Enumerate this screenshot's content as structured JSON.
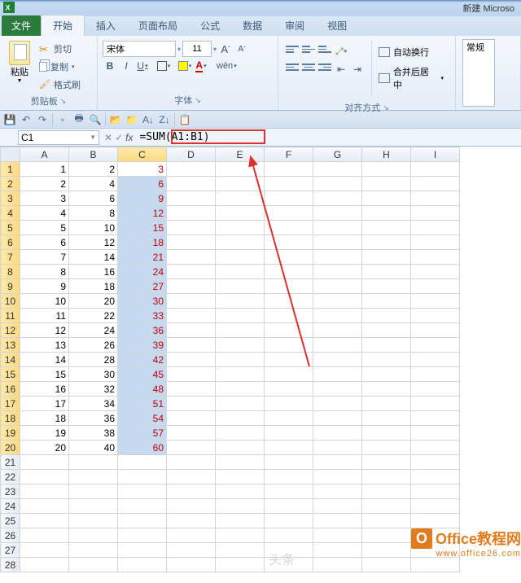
{
  "window_title": "新建 Microso",
  "tabs": {
    "file": "文件",
    "items": [
      "开始",
      "插入",
      "页面布局",
      "公式",
      "数据",
      "审阅",
      "视图"
    ],
    "active": 0
  },
  "clipboard": {
    "paste": "粘贴",
    "cut": "剪切",
    "copy": "复制",
    "painter": "格式刷",
    "label": "剪贴板"
  },
  "font": {
    "name": "宋体",
    "size": "11",
    "bold": "B",
    "italic": "I",
    "underline": "U",
    "inc": "A",
    "dec": "A",
    "label": "字体"
  },
  "align": {
    "wrap": "自动换行",
    "merge": "合并后居中",
    "label": "对齐方式"
  },
  "number": {
    "format": "常规"
  },
  "name_box": "C1",
  "formula": "=SUM(A1:B1)",
  "columns": [
    "A",
    "B",
    "C",
    "D",
    "E",
    "F",
    "G",
    "H",
    "I"
  ],
  "selected_col": "C",
  "rows": 28,
  "sel_rows": [
    1,
    20
  ],
  "chart_data": {
    "type": "table",
    "columns": [
      "A",
      "B",
      "C"
    ],
    "data": [
      [
        1,
        2,
        3
      ],
      [
        2,
        4,
        6
      ],
      [
        3,
        6,
        9
      ],
      [
        4,
        8,
        12
      ],
      [
        5,
        10,
        15
      ],
      [
        6,
        12,
        18
      ],
      [
        7,
        14,
        21
      ],
      [
        8,
        16,
        24
      ],
      [
        9,
        18,
        27
      ],
      [
        10,
        20,
        30
      ],
      [
        11,
        22,
        33
      ],
      [
        12,
        24,
        36
      ],
      [
        13,
        26,
        39
      ],
      [
        14,
        28,
        42
      ],
      [
        15,
        30,
        45
      ],
      [
        16,
        32,
        48
      ],
      [
        17,
        34,
        51
      ],
      [
        18,
        36,
        54
      ],
      [
        19,
        38,
        57
      ],
      [
        20,
        40,
        60
      ]
    ]
  },
  "watermark": {
    "brand": "Office教程网",
    "url": "www.office26.com",
    "extra": "头条"
  }
}
